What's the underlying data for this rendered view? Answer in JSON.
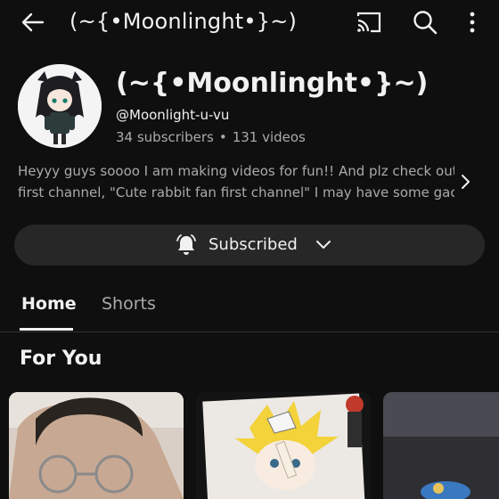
{
  "header": {
    "title": "(~{•Moonlinght•}~)",
    "icons": [
      "back-arrow-icon",
      "cast-icon",
      "search-icon",
      "more-vertical-icon"
    ]
  },
  "channel": {
    "name": "(~{•Moonlinght•}~)",
    "handle": "@Moonlight-u-vu",
    "subscribers": "34 subscribers",
    "separator": "•",
    "videos": "131 videos",
    "description_line1": "Heyyy guys soooo I am making videos for fun!! And plz check out my",
    "description_line2": "first channel, \"Cute rabbit fan first channel\" I may have some gacha..."
  },
  "subscribe": {
    "label": "Subscribed"
  },
  "tabs": [
    {
      "label": "Home",
      "active": true
    },
    {
      "label": "Shorts",
      "active": false
    }
  ],
  "section": {
    "title": "For You"
  },
  "colors": {
    "background": "#0f0f0f",
    "button": "#272727",
    "primary_text": "#f1f1f1",
    "secondary_text": "#aaaaaa"
  }
}
